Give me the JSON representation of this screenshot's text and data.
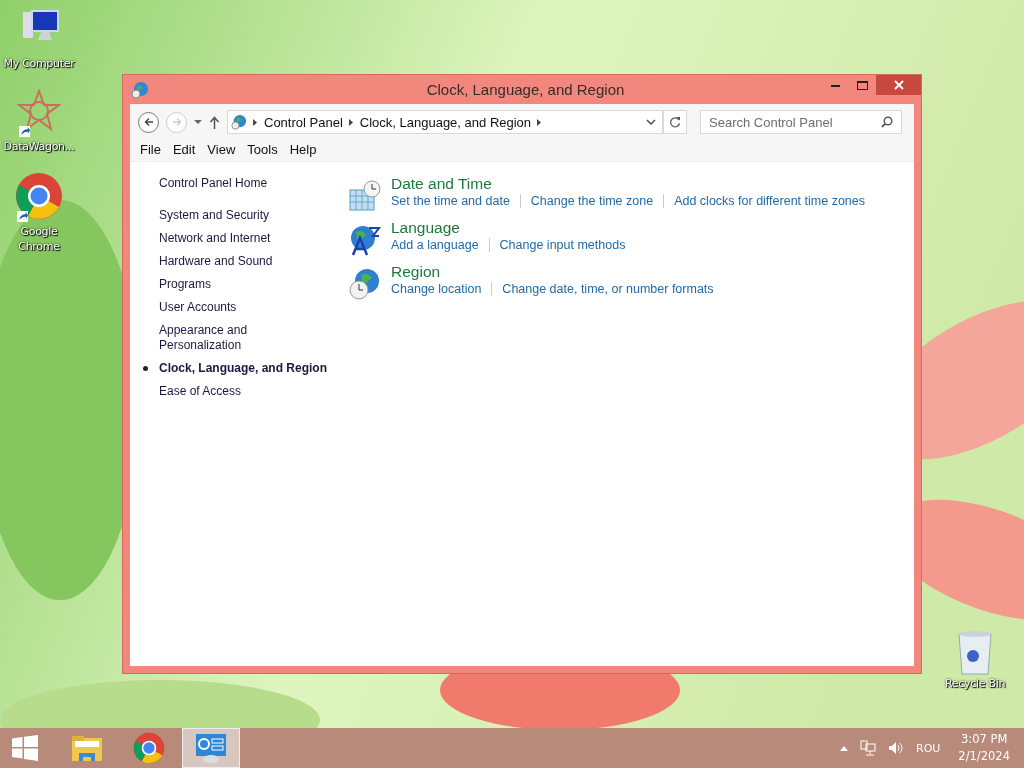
{
  "desktop": {
    "icons": [
      {
        "kind": "computer",
        "label": "My Computer",
        "shortcut": false
      },
      {
        "kind": "star",
        "label": "DataWagon...",
        "shortcut": true
      },
      {
        "kind": "chrome",
        "label": "Google Chrome",
        "shortcut": true
      }
    ],
    "recycle_bin": {
      "label": "Recycle Bin"
    }
  },
  "window": {
    "title": "Clock, Language, and Region",
    "nav": {
      "back_disabled": false,
      "forward_disabled": true
    },
    "breadcrumbs": [
      "Control Panel",
      "Clock, Language, and Region"
    ],
    "search": {
      "placeholder": "Search Control Panel"
    },
    "menu": [
      "File",
      "Edit",
      "View",
      "Tools",
      "Help"
    ],
    "sidebar": {
      "home": "Control Panel Home",
      "items": [
        {
          "label": "System and Security",
          "selected": false
        },
        {
          "label": "Network and Internet",
          "selected": false
        },
        {
          "label": "Hardware and Sound",
          "selected": false
        },
        {
          "label": "Programs",
          "selected": false
        },
        {
          "label": "User Accounts",
          "selected": false
        },
        {
          "label": "Appearance and Personalization",
          "selected": false
        },
        {
          "label": "Clock, Language, and Region",
          "selected": true
        },
        {
          "label": "Ease of Access",
          "selected": false
        }
      ]
    },
    "sections": [
      {
        "kind": "datetime",
        "title": "Date and Time",
        "links": [
          "Set the time and date",
          "Change the time zone",
          "Add clocks for different time zones"
        ]
      },
      {
        "kind": "language",
        "title": "Language",
        "links": [
          "Add a language",
          "Change input methods"
        ]
      },
      {
        "kind": "region",
        "title": "Region",
        "links": [
          "Change location",
          "Change date, time, or number formats"
        ]
      }
    ]
  },
  "taskbar": {
    "apps": [
      {
        "kind": "explorer",
        "selected": false
      },
      {
        "kind": "chrome",
        "selected": false
      },
      {
        "kind": "control-panel",
        "selected": true
      }
    ],
    "tray": {
      "language": "ROU",
      "time": "3:07 PM",
      "date": "2/1/2024"
    }
  }
}
